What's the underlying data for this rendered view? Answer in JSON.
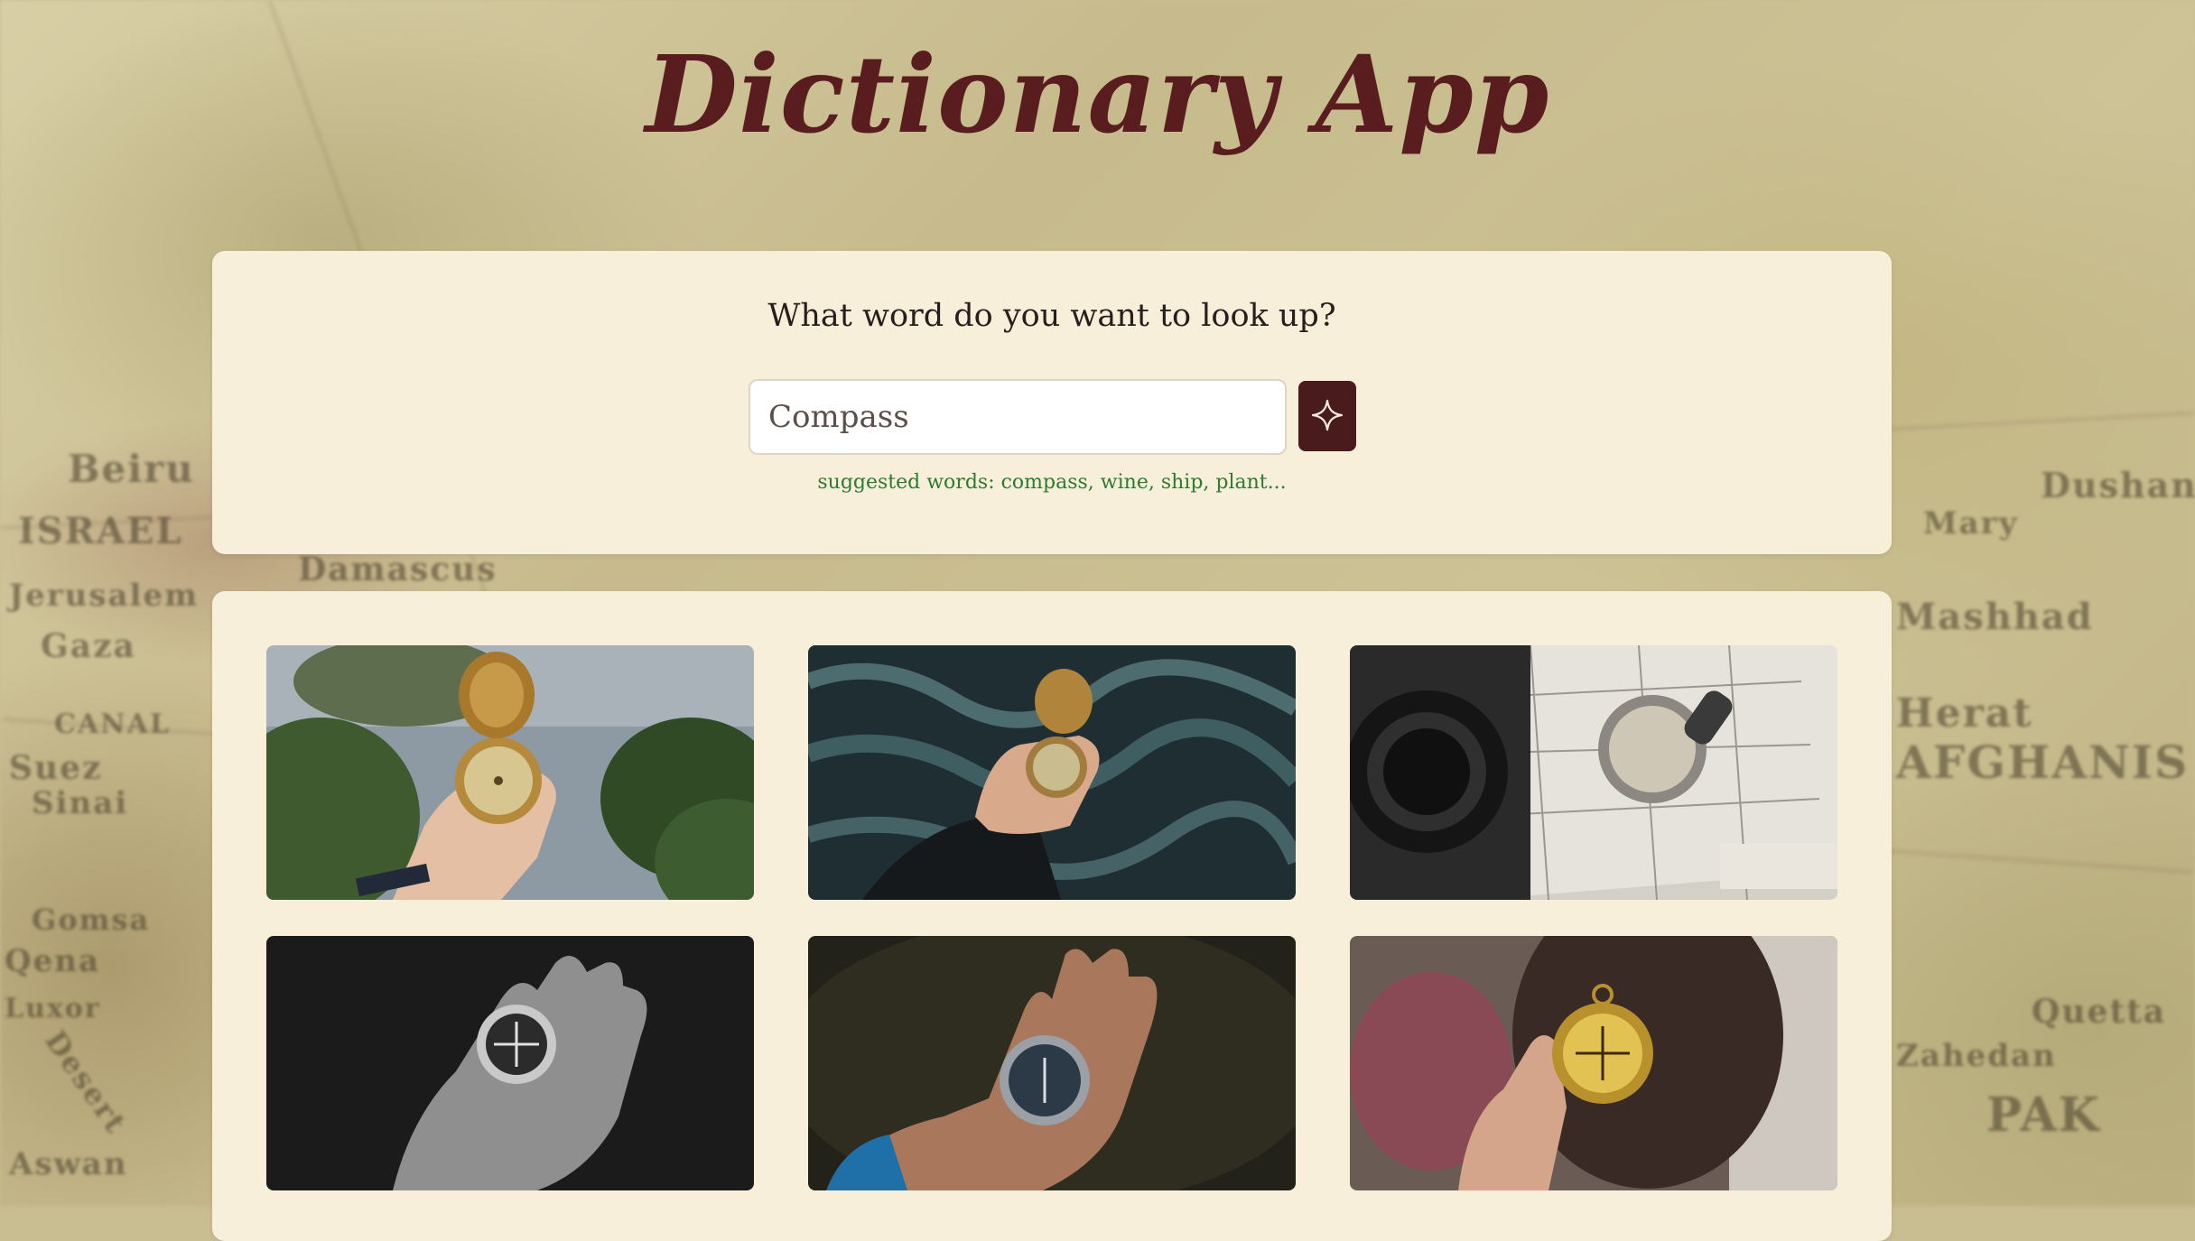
{
  "app": {
    "title": "Dictionary App"
  },
  "search": {
    "question": "What word do you want to look up?",
    "value": "Compass",
    "button_icon": "sparkle-icon",
    "hint": "suggested words: compass, wine, ship, plant..."
  },
  "results": {
    "photos": [
      {
        "name": "photo-compass-hand-coast",
        "icon": "compass-photo"
      },
      {
        "name": "photo-compass-hand-pine",
        "icon": "compass-photo"
      },
      {
        "name": "photo-compass-on-map",
        "icon": "compass-photo"
      },
      {
        "name": "photo-compass-palm-monochrome",
        "icon": "compass-photo"
      },
      {
        "name": "photo-compass-palm-dark",
        "icon": "compass-photo"
      },
      {
        "name": "photo-compass-held-gold",
        "icon": "compass-photo"
      }
    ]
  },
  "colors": {
    "title": "#5a1d1f",
    "card_background": "#f7efda",
    "button_background": "#4a1b1d",
    "hint_text": "#2f7a30"
  },
  "background": {
    "map_labels": [
      "ISRAEL",
      "Beiru",
      "Jerusalem",
      "Gaza",
      "Suez",
      "Sinai",
      "Qena",
      "Luxor",
      "Aswan",
      "Damascus",
      "Herat",
      "AFGHANIS",
      "Quetta",
      "PAK",
      "Dushan",
      "Mary",
      "Mashhad",
      "Zahedan",
      "Gomsa",
      "CANAL",
      "Desert"
    ]
  }
}
